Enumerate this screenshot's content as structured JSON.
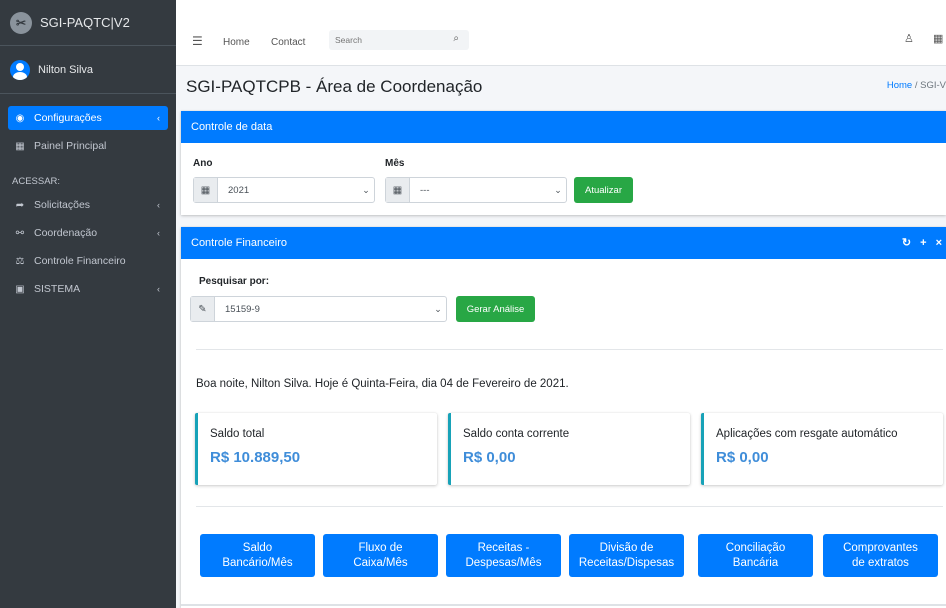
{
  "app": {
    "brand": "SGI-PAQTC|V2",
    "brand_logo": "✂"
  },
  "user": {
    "name": "Nilton Silva"
  },
  "sidebar": {
    "items": [
      {
        "label": "Configurações",
        "icon": "tachometer-icon",
        "active": true
      },
      {
        "label": "Painel Principal",
        "icon": "grid-icon"
      }
    ],
    "section_header": "ACESSAR:",
    "access_items": [
      {
        "label": "Solicitações",
        "icon": "share-icon"
      },
      {
        "label": "Coordenação",
        "icon": "sitemap-icon"
      },
      {
        "label": "Controle Financeiro",
        "icon": "balance-scale-icon"
      },
      {
        "label": "SISTEMA",
        "icon": "briefcase-icon"
      }
    ]
  },
  "topbar": {
    "home": "Home",
    "contact": "Contact",
    "search_placeholder": "Search"
  },
  "page": {
    "title": "SGI-PAQTCPB - Área de Coordenação",
    "breadcrumb_home": "Home",
    "breadcrumb_sep": " / ",
    "breadcrumb_current": "SGI-V"
  },
  "date_card": {
    "title": "Controle de data",
    "year_label": "Ano",
    "year_value": "2021",
    "month_label": "Mês",
    "month_value": "---",
    "update_button": "Atualizar"
  },
  "finance_card": {
    "title": "Controle Financeiro",
    "tools": {
      "refresh": "↻",
      "add": "+",
      "close": "×"
    },
    "search_label": "Pesquisar por:",
    "search_value": "15159-9",
    "analyze_button": "Gerar Análise",
    "greeting": "Boa noite, Nilton Silva. Hoje é Quinta-Feira, dia 04 de Fevereiro de 2021.",
    "info_boxes": [
      {
        "label": "Saldo total",
        "value": "R$ 10.889,50"
      },
      {
        "label": "Saldo conta corrente",
        "value": "R$ 0,00"
      },
      {
        "label": "Aplicações com resgate automático",
        "value": "R$ 0,00"
      }
    ],
    "buttons": [
      {
        "line1": "Saldo",
        "line2": "Bancário/Mês"
      },
      {
        "line1": "Fluxo de",
        "line2": "Caixa/Mês"
      },
      {
        "line1": "Receitas -",
        "line2": "Despesas/Mês"
      },
      {
        "line1": "Divisão de",
        "line2": "Receitas/Dispesas"
      },
      {
        "line1": "Conciliação",
        "line2": "Bancária"
      },
      {
        "line1": "Comprovantes",
        "line2": "de extratos"
      }
    ]
  },
  "colors": {
    "primary": "#007bff",
    "success": "#28a745",
    "sidebar": "#343a40",
    "accent_border": "#17a2b8",
    "value_text": "#3f8dd9"
  }
}
